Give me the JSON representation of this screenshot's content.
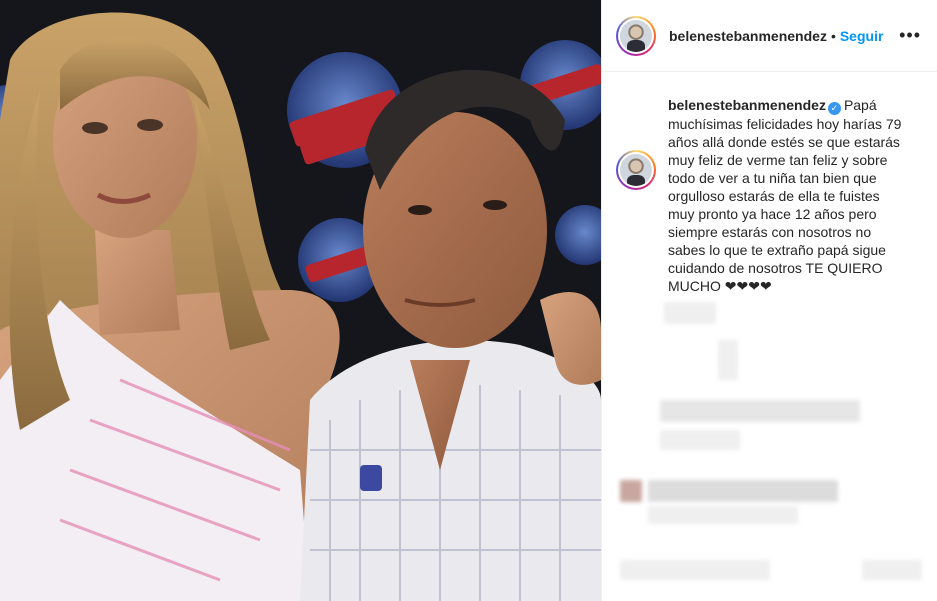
{
  "post": {
    "username": "belenestebanmenendez",
    "follow_label": "Seguir",
    "separator": "•",
    "more_icon": "more-horizontal-icon",
    "caption": "Papá muchísimas felicidades hoy harías 79 años allá donde estés se que estarás muy feliz de verme tan feliz y sobre todo de ver a tu niña tan bien que orgulloso estarás de ella te fuistes muy pronto ya hace 12 años pero siempre estarás con nosotros no sabes lo que te extraño papá sigue cuidando de nosotros TE QUIERO MUCHO ❤❤❤❤",
    "verified_icon": "verified-badge-icon"
  },
  "colors": {
    "accent": "#0095f6",
    "verified": "#3897f0",
    "text": "#262626",
    "border": "#efefef"
  }
}
